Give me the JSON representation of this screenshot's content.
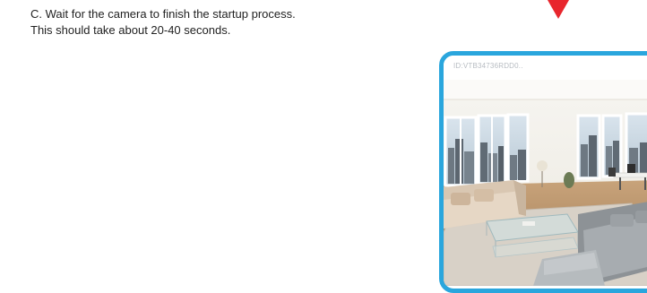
{
  "instruction": {
    "line1": "C. Wait for the camera to finish the startup process.",
    "line2": "This should take about 20-40 seconds."
  },
  "camera_preview": {
    "id_label": "ID:VTB34736RDD0..",
    "frame_color": "#2aa6dd",
    "arrow_color": "#e8262d",
    "scene": "living-room-camera-view"
  }
}
